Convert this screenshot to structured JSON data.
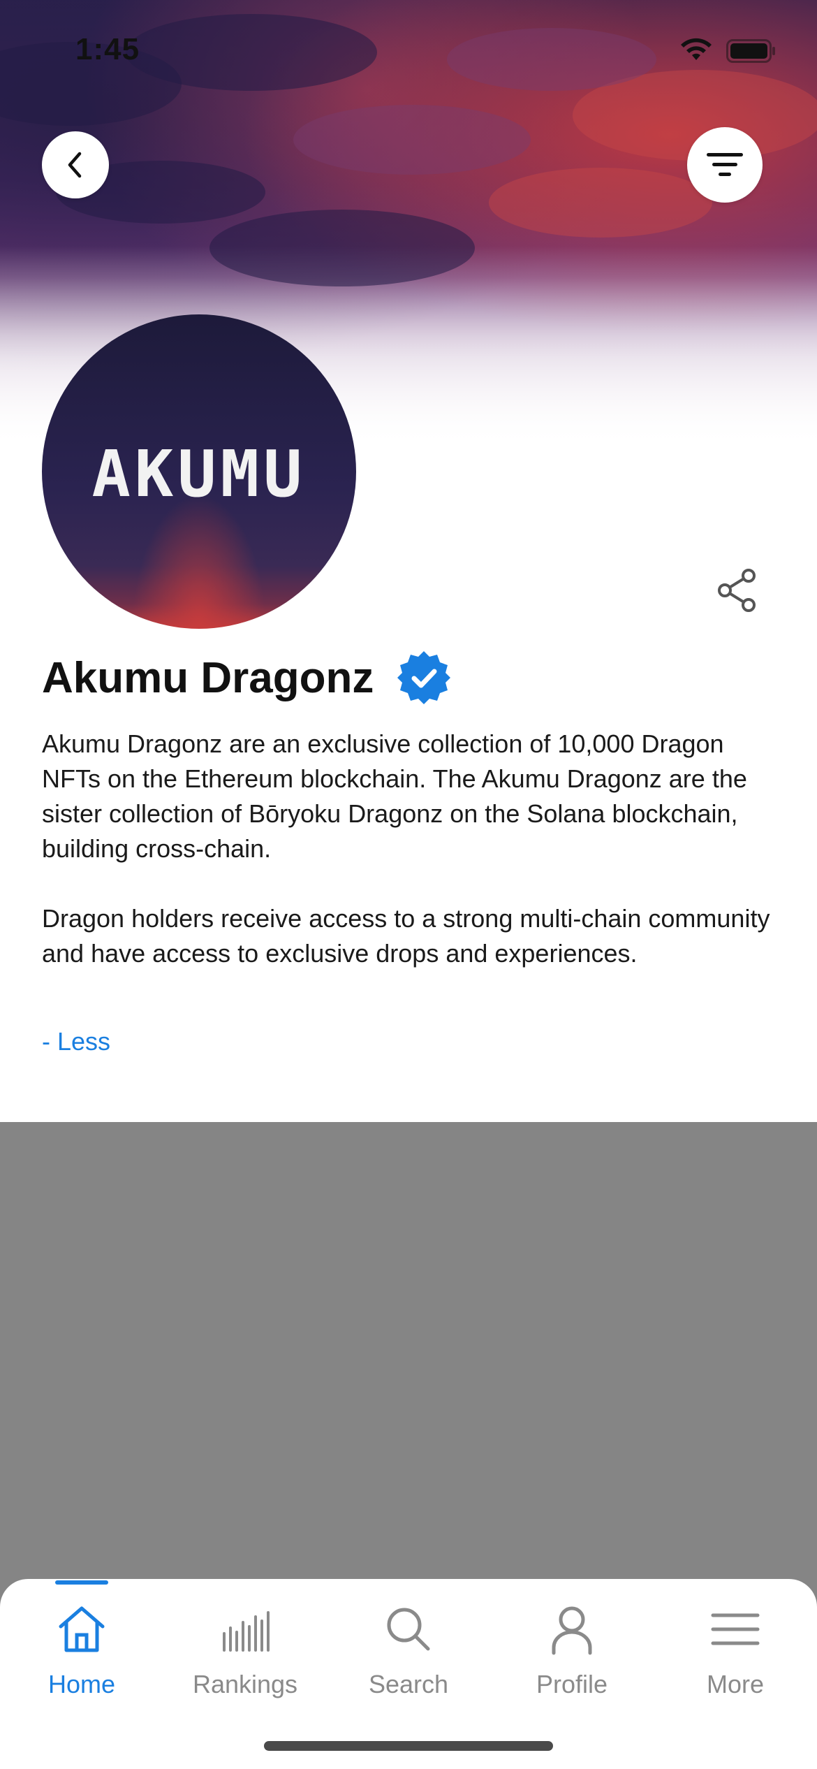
{
  "status_bar": {
    "time": "1:45",
    "icons": [
      "wifi-icon",
      "battery-icon"
    ]
  },
  "header": {
    "back_icon": "chevron-left-icon",
    "filter_icon": "filter-icon"
  },
  "collection": {
    "avatar_text": "AKUMU",
    "name": "Akumu Dragonz",
    "verified_icon": "verified-badge-icon",
    "share_icon": "share-icon",
    "description": [
      "Akumu Dragonz are an exclusive collection of 10,000 Dragon NFTs on the Ethereum blockchain. The Akumu Dragonz are the sister collection of Bōryoku Dragonz on the Solana blockchain, building cross-chain.",
      "Dragon holders receive access to a strong multi-chain community and have access to exclusive drops and experiences."
    ],
    "toggle_label": "- Less"
  },
  "tab_bar": {
    "items": [
      {
        "label": "Home",
        "icon": "home-icon",
        "active": true
      },
      {
        "label": "Rankings",
        "icon": "rankings-icon",
        "active": false
      },
      {
        "label": "Search",
        "icon": "search-icon",
        "active": false
      },
      {
        "label": "Profile",
        "icon": "profile-icon",
        "active": false
      },
      {
        "label": "More",
        "icon": "menu-icon",
        "active": false
      }
    ]
  },
  "colors": {
    "accent": "#1a7fe0",
    "overlay": "#858585",
    "inactive_tab": "#8a8a8a",
    "verified": "#1a7fe0"
  }
}
